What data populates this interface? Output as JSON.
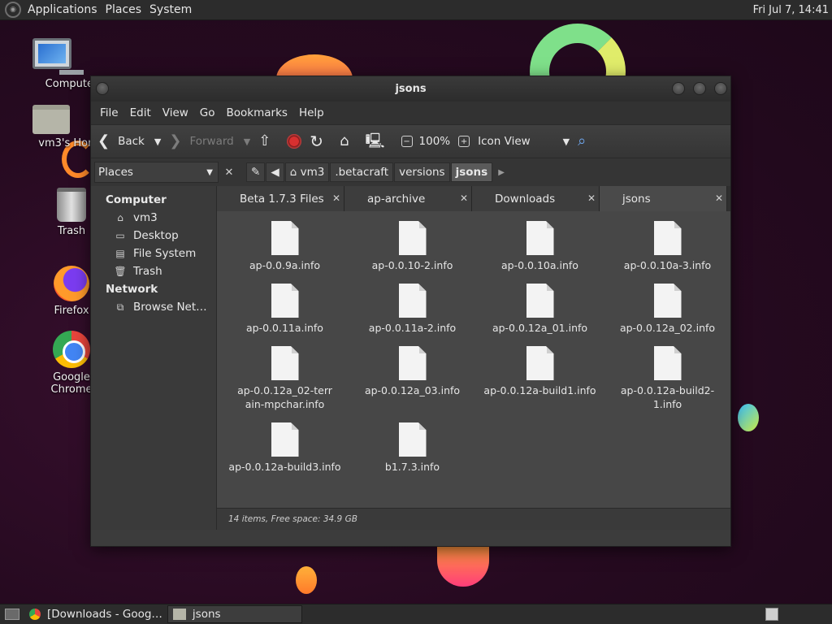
{
  "top_panel": {
    "menus": [
      "Applications",
      "Places",
      "System"
    ],
    "clock": "Fri Jul 7, 14:41"
  },
  "desktop_icons": [
    "Computer",
    "vm3's Home",
    "Trash",
    "Firefox",
    "Google Chrome"
  ],
  "window": {
    "title": "jsons",
    "menubar": [
      "File",
      "Edit",
      "View",
      "Go",
      "Bookmarks",
      "Help"
    ],
    "toolbar": {
      "back": "Back",
      "forward": "Forward",
      "zoom": "100%",
      "view_mode": "Icon View"
    },
    "places_label": "Places",
    "breadcrumbs": [
      "vm3",
      ".betacraft",
      "versions",
      "jsons"
    ],
    "sidebar": {
      "computer_header": "Computer",
      "computer_items": [
        "vm3",
        "Desktop",
        "File System",
        "Trash"
      ],
      "network_header": "Network",
      "network_items": [
        "Browse Net…"
      ]
    },
    "tabs": [
      "Beta 1.7.3 Files",
      "ap-archive",
      "Downloads",
      "jsons"
    ],
    "files": [
      "ap-0.0.9a.info",
      "ap-0.0.10-2.info",
      "ap-0.0.10a.info",
      "ap-0.0.10a-3.info",
      "ap-0.0.11a.info",
      "ap-0.0.11a-2.info",
      "ap-0.0.12a_01.info",
      "ap-0.0.12a_02.info",
      "ap-0.0.12a_02-terrain-mpchar.info",
      "ap-0.0.12a_03.info",
      "ap-0.0.12a-build1.info",
      "ap-0.0.12a-build2-1.info",
      "ap-0.0.12a-build3.info",
      "b1.7.3.info"
    ],
    "status": "14 items, Free space: 34.9 GB"
  },
  "bottom_panel": {
    "tasks": [
      "[Downloads - Goog…",
      "jsons"
    ]
  }
}
